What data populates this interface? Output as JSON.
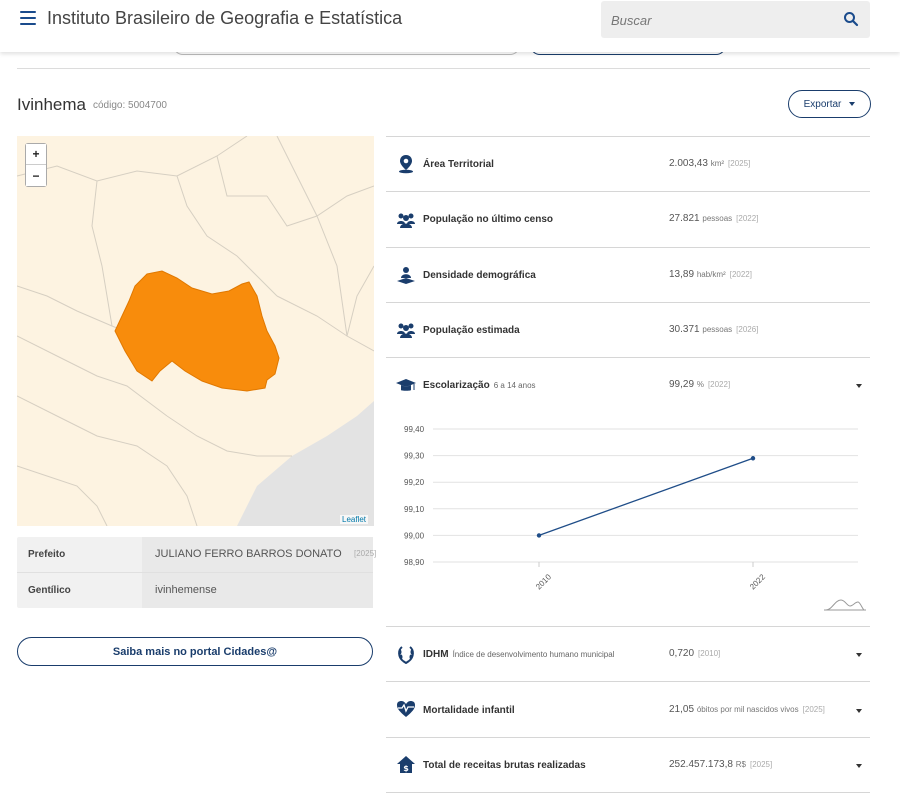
{
  "header": {
    "title": "Instituto Brasileiro de Geografia e Estatística",
    "search_placeholder": "Buscar"
  },
  "city": {
    "name": "Ivinhema",
    "code": "código: 5004700",
    "export_label": "Exportar"
  },
  "map": {
    "zoom_in": "+",
    "zoom_out": "−",
    "attribution": "Leaflet",
    "highlight_color": "#f88c0c",
    "background_color": "#fdf3e1"
  },
  "info": [
    {
      "label": "Prefeito",
      "value": "JULIANO FERRO BARROS DONATO",
      "year": "[2025]"
    },
    {
      "label": "Gentílico",
      "value": "ivinhemense",
      "year": ""
    }
  ],
  "portal_button": "Saiba mais no portal Cidades@",
  "indicators": [
    {
      "icon": "map-pin-icon",
      "label": "Área Territorial",
      "sub": "",
      "value": "2.003,43",
      "unit": "km²",
      "year": "[2025]",
      "expandable": false
    },
    {
      "icon": "people-icon",
      "label": "População no último censo",
      "sub": "",
      "value": "27.821",
      "unit": "pessoas",
      "year": "[2022]",
      "expandable": false
    },
    {
      "icon": "density-icon",
      "label": "Densidade demográfica",
      "sub": "",
      "value": "13,89",
      "unit": "hab/km²",
      "year": "[2022]",
      "expandable": false
    },
    {
      "icon": "people-icon",
      "label": "População estimada",
      "sub": "",
      "value": "30.371",
      "unit": "pessoas",
      "year": "[2026]",
      "expandable": false
    },
    {
      "icon": "graduation-cap-icon",
      "label": "Escolarização",
      "sub": "6 a 14 anos",
      "value": "99,29",
      "unit": "%",
      "year": "[2022]",
      "expandable": true
    },
    {
      "icon": "laurel-icon",
      "label": "IDHM",
      "sub": "Índice de desenvolvimento humano municipal",
      "value": "0,720",
      "unit": "",
      "year": "[2010]",
      "expandable": true
    },
    {
      "icon": "heart-pulse-icon",
      "label": "Mortalidade infantil",
      "sub": "",
      "value": "21,05",
      "unit": "óbitos por mil nascidos vivos",
      "year": "[2025]",
      "expandable": true
    },
    {
      "icon": "money-house-icon",
      "label": "Total de receitas brutas realizadas",
      "sub": "",
      "value": "252.457.173,8",
      "unit": "R$",
      "year": "[2025]",
      "expandable": true
    }
  ],
  "colors": {
    "accent": "#1a3d6c",
    "line": "#1f4d88"
  },
  "chart_data": {
    "type": "line",
    "x": [
      "2010",
      "2022"
    ],
    "series": [
      {
        "values": [
          99.0,
          99.29
        ]
      }
    ],
    "ylim": [
      98.9,
      99.4
    ],
    "yticks": [
      "99,40",
      "99,30",
      "99,20",
      "99,10",
      "99,00",
      "98,90"
    ],
    "grid": true
  }
}
